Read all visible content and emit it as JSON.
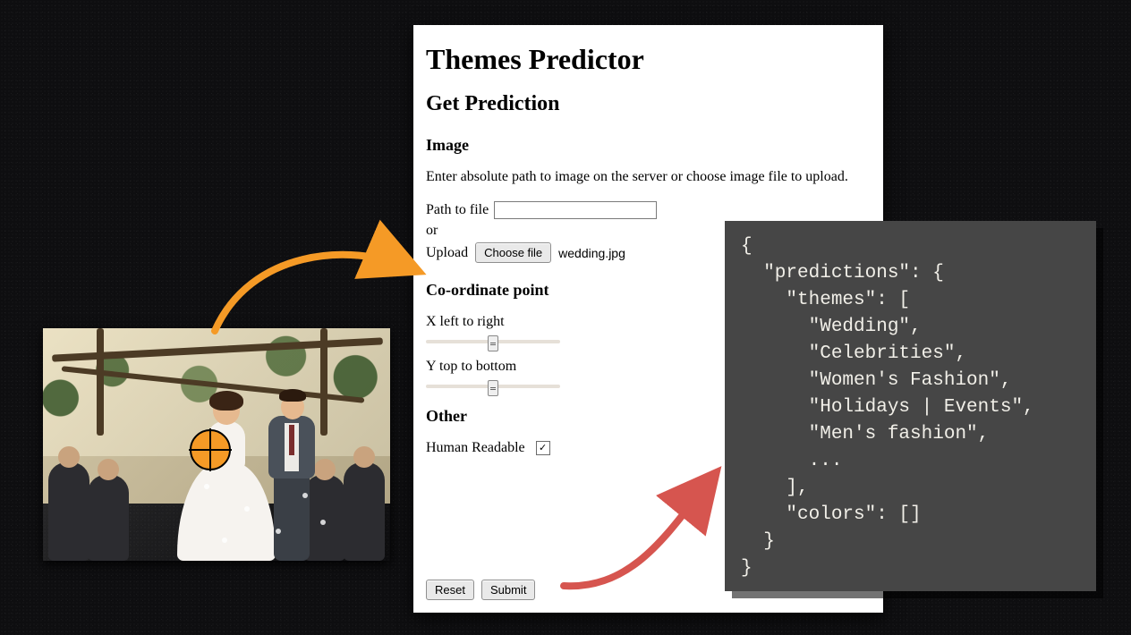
{
  "form": {
    "title": "Themes Predictor",
    "subtitle": "Get Prediction",
    "image_heading": "Image",
    "image_help": "Enter absolute path to image on the server or choose image file to upload.",
    "path_label": "Path to file",
    "path_value": "",
    "or_label": "or",
    "upload_label": "Upload",
    "choose_file_btn": "Choose file",
    "chosen_file": "wedding.jpg",
    "coord_heading": "Co-ordinate point",
    "x_label": "X left to right",
    "y_label": "Y top to bottom",
    "other_heading": "Other",
    "human_readable_label": "Human Readable",
    "human_readable_checked": true,
    "reset_btn": "Reset",
    "submit_btn": "Submit"
  },
  "json_output": "{\n  \"predictions\": {\n    \"themes\": [\n      \"Wedding\",\n      \"Celebrities\",\n      \"Women's Fashion\",\n      \"Holidays | Events\",\n      \"Men's fashion\",\n      ...\n    ],\n    \"colors\": []\n  }\n}"
}
